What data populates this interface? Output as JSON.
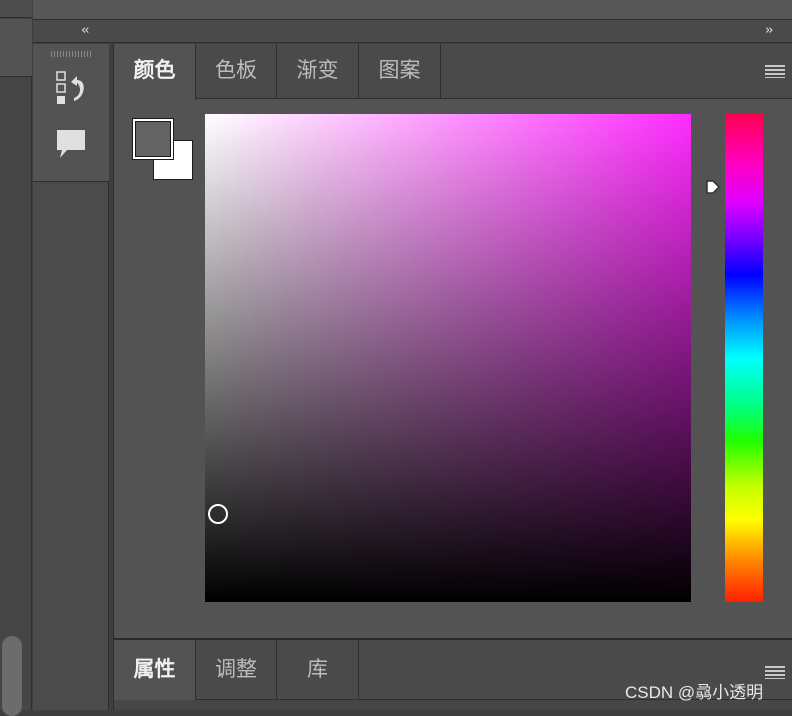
{
  "collapse_left_glyph": "‹‹",
  "expand_right_glyph": "››",
  "dock": {
    "items": [
      {
        "name": "history-icon",
        "label": ""
      },
      {
        "name": "comments-icon",
        "label": ""
      }
    ]
  },
  "color_panel": {
    "tabs": [
      {
        "label": "颜色",
        "active": true
      },
      {
        "label": "色板",
        "active": false
      },
      {
        "label": "渐变",
        "active": false
      },
      {
        "label": "图案",
        "active": false
      }
    ],
    "foreground_color": "#636363",
    "background_color": "#ffffff",
    "selected_hue_color": "#ff2cff",
    "picker_saturation": 0.0,
    "picker_brightness": 0.18,
    "hue_marker_position": 0.15
  },
  "bottom_panel": {
    "tabs": [
      {
        "label": "属性",
        "active": true
      },
      {
        "label": "调整",
        "active": false
      },
      {
        "label": "库",
        "active": false
      }
    ]
  },
  "watermark": "CSDN @骉小透明",
  "colors": {
    "panel_bg": "#535353",
    "tab_bar_bg": "#4a4a4a",
    "border": "#2e2e2e",
    "text_active": "#f0f0f0",
    "text_inactive": "#bdbdbd"
  }
}
